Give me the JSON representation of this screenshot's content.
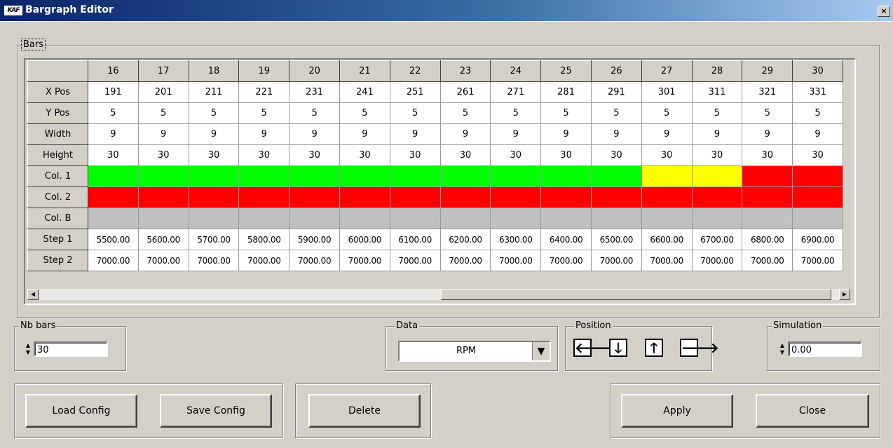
{
  "window": {
    "title": "Bargraph Editor",
    "icon_text": "KAF",
    "close_label": "×"
  },
  "bars_group": {
    "label": "Bars"
  },
  "grid": {
    "columns": [
      "16",
      "17",
      "18",
      "19",
      "20",
      "21",
      "22",
      "23",
      "24",
      "25",
      "26",
      "27",
      "28",
      "29",
      "30"
    ],
    "rows": [
      {
        "label": "X Pos",
        "type": "text",
        "values": [
          "191",
          "201",
          "211",
          "221",
          "231",
          "241",
          "251",
          "261",
          "271",
          "281",
          "291",
          "301",
          "311",
          "321",
          "331"
        ]
      },
      {
        "label": "Y Pos",
        "type": "text",
        "values": [
          "5",
          "5",
          "5",
          "5",
          "5",
          "5",
          "5",
          "5",
          "5",
          "5",
          "5",
          "5",
          "5",
          "5",
          "5"
        ]
      },
      {
        "label": "Width",
        "type": "text",
        "values": [
          "9",
          "9",
          "9",
          "9",
          "9",
          "9",
          "9",
          "9",
          "9",
          "9",
          "9",
          "9",
          "9",
          "9",
          "9"
        ]
      },
      {
        "label": "Height",
        "type": "text",
        "values": [
          "30",
          "30",
          "30",
          "30",
          "30",
          "30",
          "30",
          "30",
          "30",
          "30",
          "30",
          "30",
          "30",
          "30",
          "30"
        ]
      },
      {
        "label": "Col. 1",
        "type": "color",
        "values": [
          "#00ff00",
          "#00ff00",
          "#00ff00",
          "#00ff00",
          "#00ff00",
          "#00ff00",
          "#00ff00",
          "#00ff00",
          "#00ff00",
          "#00ff00",
          "#00ff00",
          "#ffff00",
          "#ffff00",
          "#ff0000",
          "#ff0000"
        ]
      },
      {
        "label": "Col. 2",
        "type": "color",
        "values": [
          "#ff0000",
          "#ff0000",
          "#ff0000",
          "#ff0000",
          "#ff0000",
          "#ff0000",
          "#ff0000",
          "#ff0000",
          "#ff0000",
          "#ff0000",
          "#ff0000",
          "#ff0000",
          "#ff0000",
          "#ff0000",
          "#ff0000"
        ]
      },
      {
        "label": "Col. B",
        "type": "color",
        "values": [
          "#c0c0c0",
          "#c0c0c0",
          "#c0c0c0",
          "#c0c0c0",
          "#c0c0c0",
          "#c0c0c0",
          "#c0c0c0",
          "#c0c0c0",
          "#c0c0c0",
          "#c0c0c0",
          "#c0c0c0",
          "#c0c0c0",
          "#c0c0c0",
          "#c0c0c0",
          "#c0c0c0"
        ]
      },
      {
        "label": "Step 1",
        "type": "text",
        "values": [
          "5500.00",
          "5600.00",
          "5700.00",
          "5800.00",
          "5900.00",
          "6000.00",
          "6100.00",
          "6200.00",
          "6300.00",
          "6400.00",
          "6500.00",
          "6600.00",
          "6700.00",
          "6800.00",
          "6900.00"
        ]
      },
      {
        "label": "Step 2",
        "type": "text",
        "values": [
          "7000.00",
          "7000.00",
          "7000.00",
          "7000.00",
          "7000.00",
          "7000.00",
          "7000.00",
          "7000.00",
          "7000.00",
          "7000.00",
          "7000.00",
          "7000.00",
          "7000.00",
          "7000.00",
          "7000.00"
        ]
      }
    ]
  },
  "nb_bars": {
    "label": "Nb bars",
    "value": "30"
  },
  "data_select": {
    "label": "Data",
    "value": "RPM"
  },
  "position": {
    "label": "Position",
    "left": "🡐",
    "down": "🡓",
    "up": "🡑",
    "right": "🡒"
  },
  "simulation": {
    "label": "Simulation",
    "value": "0.00"
  },
  "buttons": {
    "load": "Load Config",
    "save": "Save Config",
    "delete": "Delete",
    "apply": "Apply",
    "close": "Close"
  }
}
